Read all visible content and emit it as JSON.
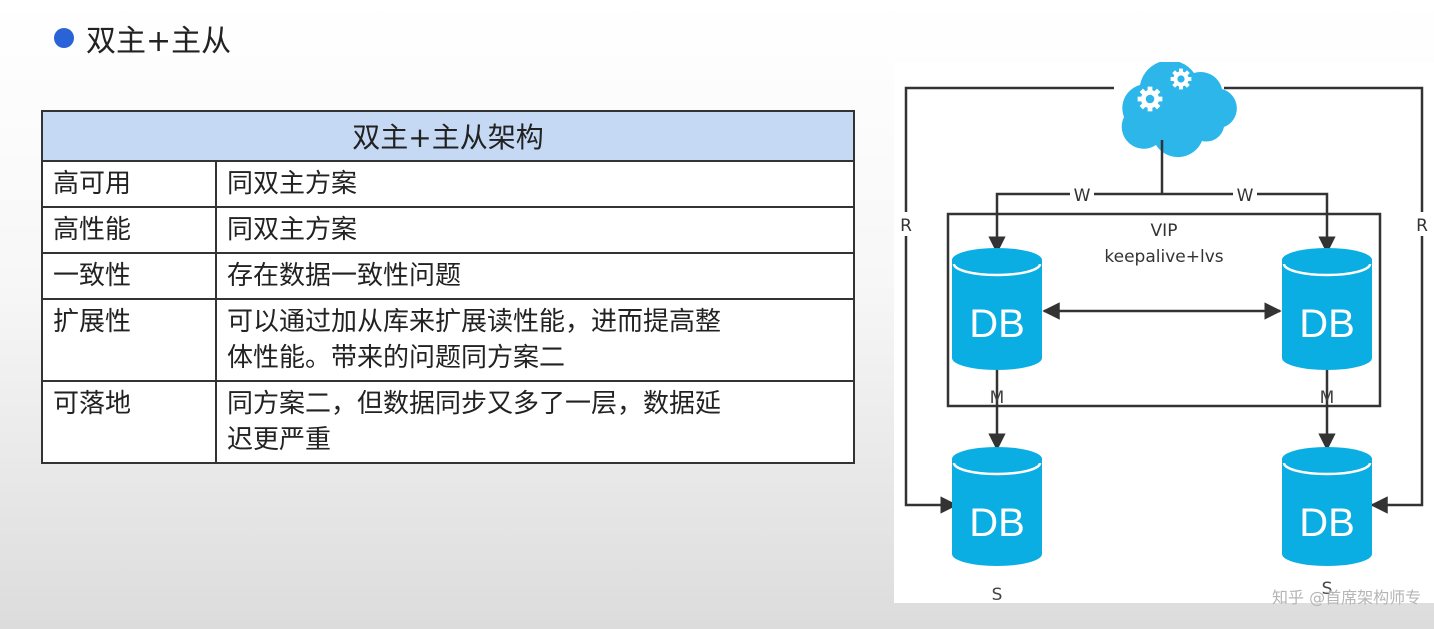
{
  "heading": "双主+主从",
  "table": {
    "title": "双主+主从架构",
    "rows": [
      {
        "label": "高可用",
        "value": "同双主方案"
      },
      {
        "label": "高性能",
        "value": "同双主方案"
      },
      {
        "label": "一致性",
        "value": "存在数据一致性问题"
      },
      {
        "label": "扩展性",
        "value": "可以通过加从库来扩展读性能，进而提高整",
        "value2": "体性能。带来的问题同方案二"
      },
      {
        "label": "可落地",
        "value": "同方案二，但数据同步又多了一层，数据延",
        "value2": "迟更严重"
      }
    ]
  },
  "diagram": {
    "db_label": "DB",
    "vip_label": "VIP",
    "vip_sub": "keepalive+lvs",
    "write_label": "W",
    "read_label": "R",
    "master_label": "M",
    "slave_label": "S",
    "watermark": "知乎 @首席架构师专",
    "colors": {
      "db": "#0aaee3",
      "cloud": "#2cb6ea",
      "line": "#333333"
    }
  }
}
